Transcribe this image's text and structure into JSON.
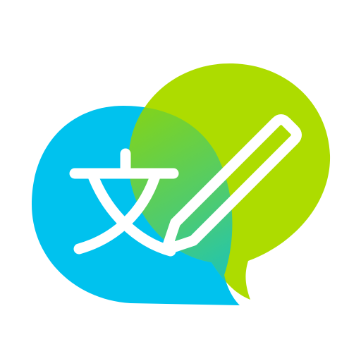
{
  "icon": {
    "name": "translate-edit-app-icon",
    "glyph": "文",
    "background_color": "#FFFFFF",
    "colors": {
      "blue_bubble": "#00C2EE",
      "green_bubble": "#ADDC00",
      "overlap_gradient_start": "#7ED321",
      "overlap_gradient_end": "#1BC7B8",
      "foreground": "#FFFFFF"
    }
  }
}
